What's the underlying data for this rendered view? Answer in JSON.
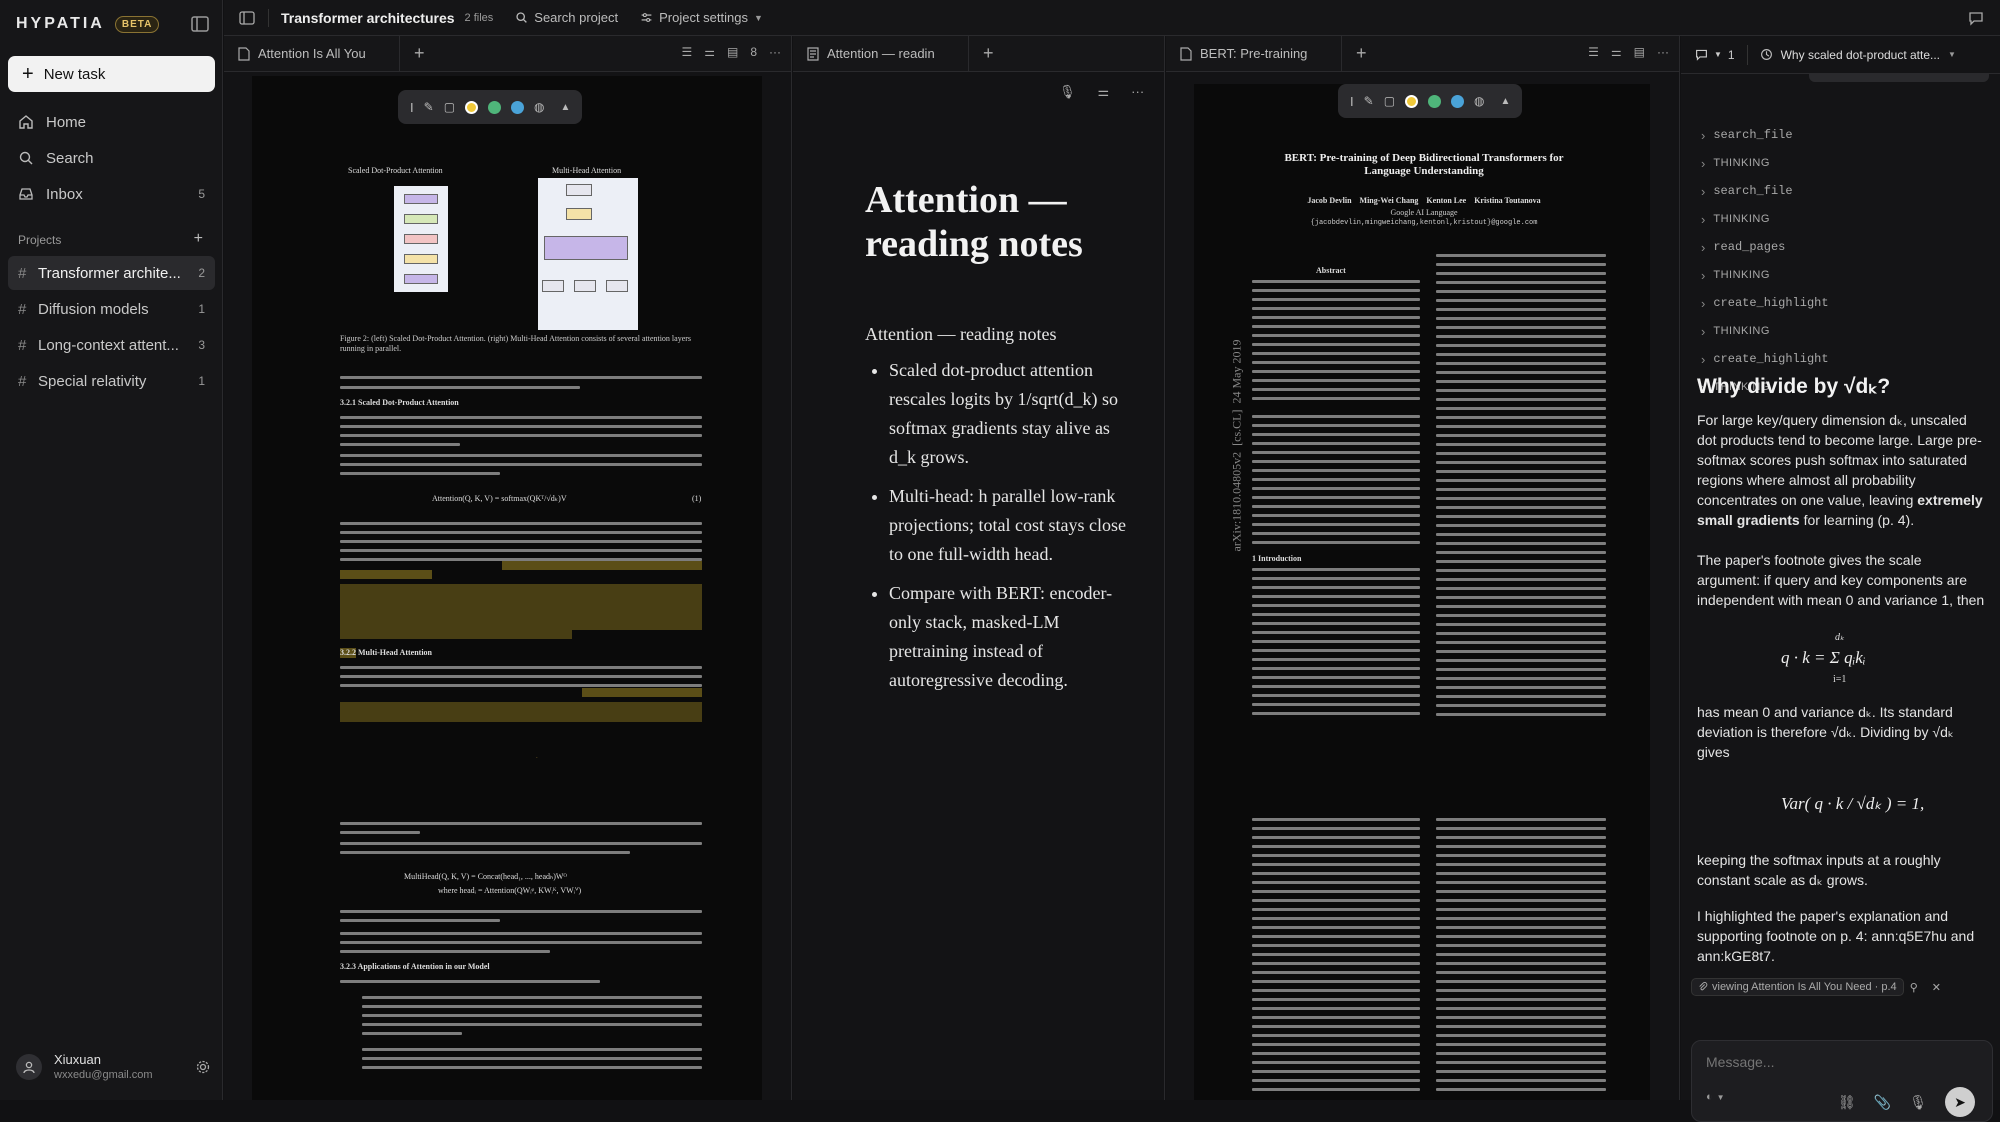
{
  "sidebar": {
    "logo": "HYPATIA",
    "badge": "BETA",
    "new_task": "New task",
    "nav": [
      {
        "label": "Home",
        "icon": "home-icon",
        "count": ""
      },
      {
        "label": "Search",
        "icon": "search-icon",
        "count": ""
      },
      {
        "label": "Inbox",
        "icon": "inbox-icon",
        "count": "5"
      }
    ],
    "projects_header": "Projects",
    "projects": [
      {
        "label": "Transformer archite...",
        "count": "2"
      },
      {
        "label": "Diffusion models",
        "count": "1"
      },
      {
        "label": "Long-context attent...",
        "count": "3"
      },
      {
        "label": "Special relativity",
        "count": "1"
      }
    ],
    "user": {
      "name": "Xiuxuan",
      "email": "wxxedu@gmail.com"
    }
  },
  "topbar": {
    "title": "Transformer architectures",
    "files": "2 files",
    "search": "Search project",
    "settings": "Project settings"
  },
  "pane1": {
    "tab": "Attention Is All You",
    "page_count": "8",
    "fig_left": "Scaled Dot-Product Attention",
    "fig_right": "Multi-Head Attention",
    "caption": "Figure 2: (left) Scaled Dot-Product Attention. (right) Multi-Head Attention consists of several attention layers running in parallel.",
    "sec_321": "3.2.1   Scaled Dot-Product Attention",
    "sec_322": "3.2.2   Multi-Head Attention",
    "sec_323": "3.2.3   Applications of Attention in our Model",
    "eq1": "Attention(Q, K, V) = softmax(QKᵀ/√dₖ)V",
    "eq1_num": "(1)",
    "multihead": "MultiHead(Q, K, V) = Concat(head₁, ..., headₕ)Wᴼ",
    "head_i": "where headᵢ = Attention(QWᵢᵠ, KWᵢᴷ, VWᵢⱽ)",
    "page_num": "4"
  },
  "pane2": {
    "tab": "Attention — readin",
    "title": "Attention — reading notes",
    "subtitle": "Attention — reading notes",
    "bullets": [
      "Scaled dot-product attention rescales logits by 1/sqrt(d_k) so softmax gradients stay alive as d_k grows.",
      "Multi-head: h parallel low-rank projections; total cost stays close to one full-width head.",
      "Compare with BERT: encoder-only stack, masked-LM pretraining instead of autoregressive decoding."
    ]
  },
  "pane3": {
    "tab": "BERT: Pre-training",
    "title": "BERT: Pre-training of Deep Bidirectional Transformers for Language Understanding",
    "authors": "Jacob Devlin    Ming-Wei Chang    Kenton Lee    Kristina Toutanova",
    "affil": "Google AI Language",
    "emails": "{jacobdevlin,mingweichang,kentonl,kristout}@google.com",
    "arxiv": "arXiv:1810.04805v2  [cs.CL]  24 May 2019",
    "abstract": "Abstract",
    "intro": "1   Introduction"
  },
  "chat": {
    "mode_count": "1",
    "thread_title": "Why scaled dot-product atte...",
    "steps": [
      {
        "kind": "tool",
        "label": "search_file"
      },
      {
        "kind": "think",
        "label": "THINKING"
      },
      {
        "kind": "tool",
        "label": "search_file"
      },
      {
        "kind": "think",
        "label": "THINKING"
      },
      {
        "kind": "tool",
        "label": "read_pages"
      },
      {
        "kind": "think",
        "label": "THINKING"
      },
      {
        "kind": "tool",
        "label": "create_highlight"
      },
      {
        "kind": "think",
        "label": "THINKING"
      },
      {
        "kind": "tool",
        "label": "create_highlight"
      },
      {
        "kind": "think",
        "label": "THINKING"
      }
    ],
    "heading": "Why divide by √dₖ?",
    "p1a": "For large key/query dimension dₖ, unscaled dot products tend to become large. Large pre-softmax scores push softmax into saturated regions where almost all probability concentrates on one value, leaving ",
    "p1b": "extremely small gradients",
    "p1c": " for learning (p. 4).",
    "p2": "The paper's footnote gives the scale argument: if query and key components are independent with mean 0 and variance 1, then",
    "eq_sum": "q · k = Σ qᵢkᵢ",
    "eq_sum_top": "dₖ",
    "eq_sum_bot": "i=1",
    "p3": "has mean 0 and variance dₖ. Its standard deviation is therefore √dₖ. Dividing by √dₖ gives",
    "eq_var": "Var( q · k / √dₖ ) = 1,",
    "p4": "keeping the softmax inputs at a roughly constant scale as dₖ grows.",
    "p5": "I highlighted the paper's explanation and supporting footnote on p. 4: ann:q5E7hu and ann:kGE8t7.",
    "context": "viewing Attention Is All You Need · p.4",
    "placeholder": "Message..."
  }
}
